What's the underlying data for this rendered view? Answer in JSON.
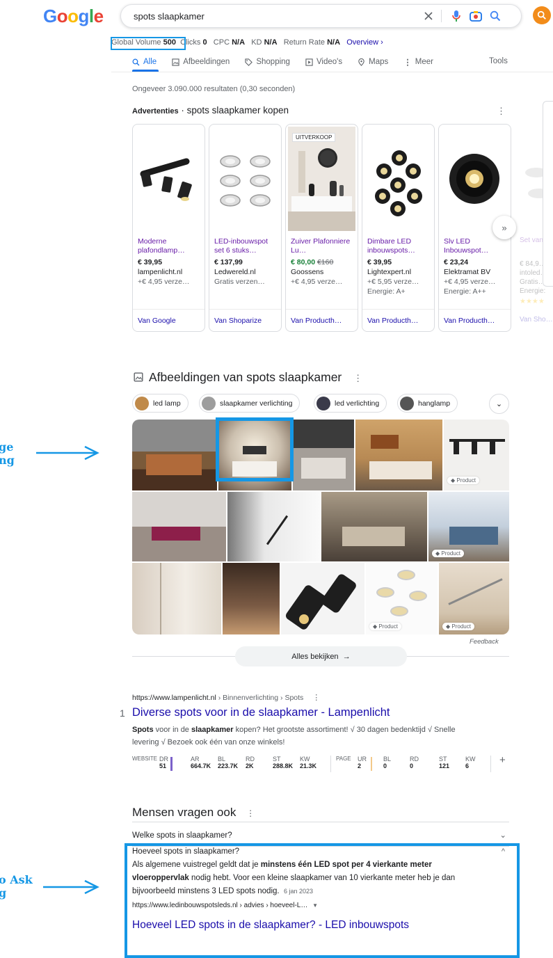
{
  "header": {
    "logo": "Google",
    "query": "spots slaapkamer"
  },
  "metrics": {
    "gv_label": "Global Volume",
    "gv_value": "500",
    "clicks_label": "Clicks",
    "clicks_value": "0",
    "cpc_label": "CPC",
    "cpc_value": "N/A",
    "kd_label": "KD",
    "kd_value": "N/A",
    "rr_label": "Return Rate",
    "rr_value": "N/A",
    "overview": "Overview ›"
  },
  "tabs": [
    {
      "label": "Alle",
      "icon": "search-icon"
    },
    {
      "label": "Afbeeldingen",
      "icon": "image-icon"
    },
    {
      "label": "Shopping",
      "icon": "tag-icon"
    },
    {
      "label": "Video's",
      "icon": "play-icon"
    },
    {
      "label": "Maps",
      "icon": "pin-icon"
    },
    {
      "label": "Meer",
      "icon": "more-vert-icon"
    }
  ],
  "tools": "Tools",
  "result_count": "Ongeveer 3.090.000 resultaten (0,30 seconden)",
  "ads": {
    "label": "Advertenties",
    "title": "spots slaapkamer kopen",
    "cards": [
      {
        "title": "Moderne plafondlamp…",
        "price": "€ 39,95",
        "old_price": "",
        "shop": "lampenlicht.nl",
        "shipping": "+€ 4,95 verze…",
        "energy": "",
        "from": "Van Google",
        "badge": ""
      },
      {
        "title": "LED-inbouwspot set 6 stuks…",
        "price": "€ 137,99",
        "old_price": "",
        "shop": "Ledwereld.nl",
        "shipping": "Gratis verzen…",
        "energy": "",
        "from": "Van Shoparize",
        "badge": ""
      },
      {
        "title": "Zuiver Plafonniere Lu…",
        "price": "€ 80,00",
        "old_price": "€160",
        "shop": "Goossens",
        "shipping": "+€ 4,95 verze…",
        "energy": "",
        "from": "Van Producth…",
        "badge": "UITVERKOOP"
      },
      {
        "title": "Dimbare LED inbouwspots…",
        "price": "€ 39,95",
        "old_price": "",
        "shop": "Lightexpert.nl",
        "shipping": "+€ 5,95 verze…",
        "energy": "Energie: A+",
        "from": "Van Producth…",
        "badge": ""
      },
      {
        "title": "Slv LED Inbouwspot…",
        "price": "€ 23,24",
        "old_price": "",
        "shop": "Elektramat BV",
        "shipping": "+€ 4,95 verze…",
        "energy": "Energie: A++",
        "from": "Van Producth…",
        "badge": ""
      }
    ],
    "partial_card": {
      "title": "Set van dimba… inbouw…",
      "price": "€ 84,9…",
      "shop": "intoled…",
      "shipping": "Gratis…",
      "energy": "Energie:",
      "from": "Van Sho…"
    }
  },
  "images": {
    "title": "Afbeeldingen van spots slaapkamer",
    "chips": [
      "led lamp",
      "slaapkamer verlichting",
      "led verlichting",
      "hanglamp"
    ],
    "product_label": "Product",
    "feedback": "Feedback",
    "view_all": "Alles bekijken"
  },
  "annotations": {
    "image_ranking": "ge\nng",
    "paa_ranking": "o Ask\ng"
  },
  "organic": {
    "rank": "1",
    "url_domain": "https://www.lampenlicht.nl",
    "url_crumbs": " › Binnenverlichting › Spots",
    "title": "Diverse spots voor in de slaapkamer - Lampenlicht",
    "snippet_1a": "Spots",
    "snippet_1b": " voor in de ",
    "snippet_1c": "slaapkamer",
    "snippet_1d": " kopen? Het grootste assortiment! √ 30 dagen bedenktijd √ Snelle",
    "snippet_2": "levering √ Bezoek ook één van onze winkels!",
    "seo": {
      "website_label": "WEBSITE",
      "page_label": "PAGE",
      "website": [
        {
          "k": "DR",
          "v": "51"
        },
        {
          "k": "AR",
          "v": "664.7K"
        },
        {
          "k": "BL",
          "v": "223.7K"
        },
        {
          "k": "RD",
          "v": "2K"
        },
        {
          "k": "ST",
          "v": "288.8K"
        },
        {
          "k": "KW",
          "v": "21.3K"
        }
      ],
      "page": [
        {
          "k": "UR",
          "v": "2"
        },
        {
          "k": "BL",
          "v": "0"
        },
        {
          "k": "RD",
          "v": "0"
        },
        {
          "k": "ST",
          "v": "121"
        },
        {
          "k": "KW",
          "v": "6"
        }
      ]
    }
  },
  "paa": {
    "title": "Mensen vragen ook",
    "q1": "Welke spots in slaapkamer?",
    "q2": "Hoeveel spots in slaapkamer?",
    "ans_a": "Als algemene vuistregel geldt dat je ",
    "ans_b": "minstens één LED spot per 4 vierkante meter",
    "ans_c": "vloeroppervlak",
    "ans_d": " nodig hebt. Voor een kleine slaapkamer van 10 vierkante meter heb je dan",
    "ans_e": "bijvoorbeeld minstens 3 LED spots nodig.",
    "date": "6 jan 2023",
    "url": "https://www.ledinbouwspotsleds.nl › advies › hoeveel-L…",
    "link": "Hoeveel LED spots in de slaapkamer? - LED inbouwspots"
  },
  "colors": {
    "accent_annotation": "#1597e5",
    "link": "#1a0dab",
    "visited": "#681da8",
    "tab_active": "#1a73e8"
  }
}
